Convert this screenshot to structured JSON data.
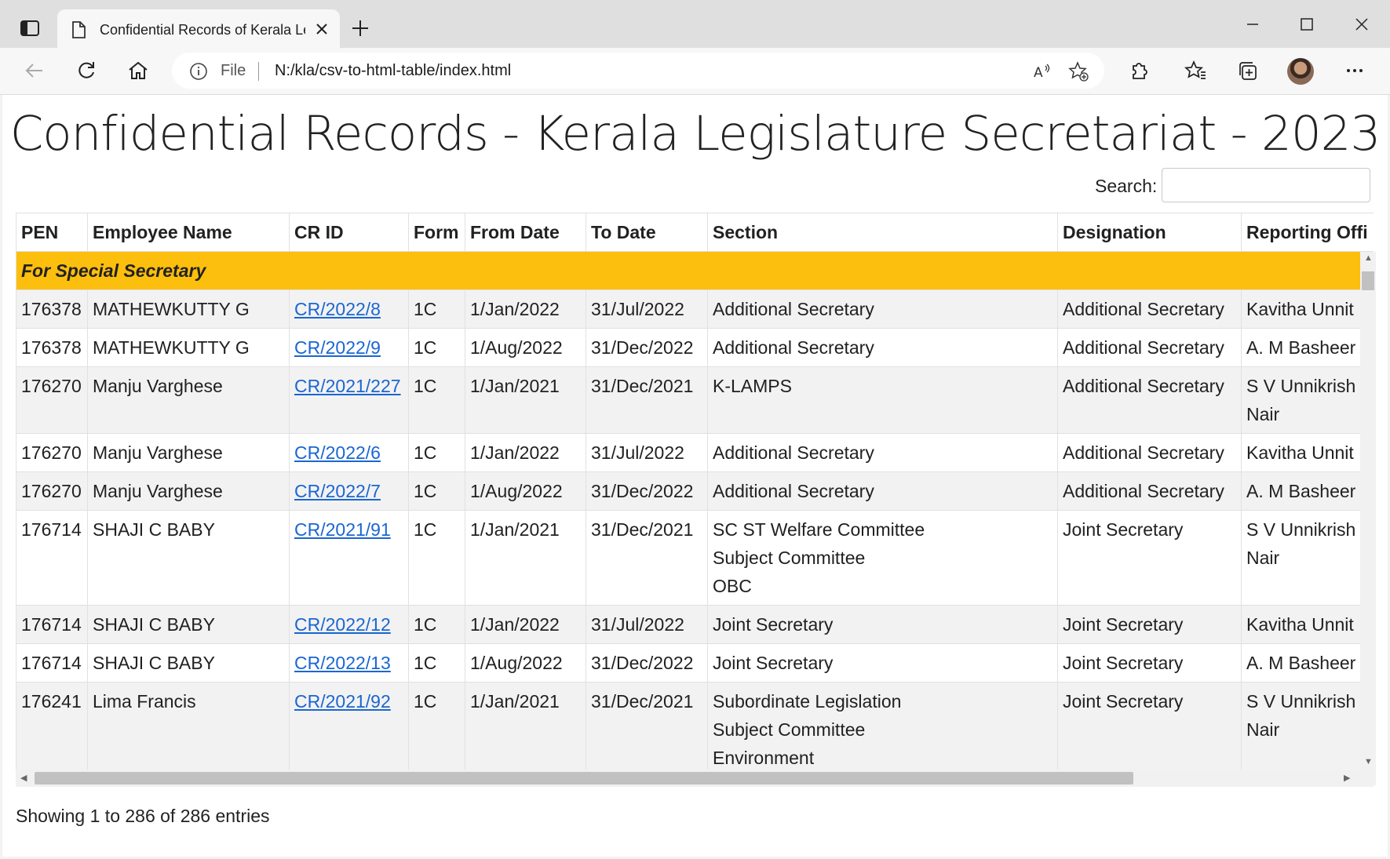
{
  "browser": {
    "tab_title": "Confidential Records of Kerala Le",
    "address_prefix": "File",
    "url": "N:/kla/csv-to-html-table/index.html"
  },
  "page": {
    "title": "Confidential Records - Kerala Legislature Secretariat - 2023",
    "search_label": "Search:",
    "search_value": "",
    "info": "Showing 1 to 286 of 286 entries"
  },
  "table": {
    "headers": [
      "PEN",
      "Employee Name",
      "CR ID",
      "Form",
      "From Date",
      "To Date",
      "Section",
      "Designation",
      "Reporting Offi"
    ],
    "group": "For Special Secretary",
    "rows": [
      {
        "pen": "176378",
        "name": "MATHEWKUTTY G",
        "cr": "CR/2022/8",
        "form": "1C",
        "from": "1/Jan/2022",
        "to": "31/Jul/2022",
        "section": [
          "Additional Secretary"
        ],
        "designation": "Additional Secretary",
        "officer": [
          "Kavitha Unnit"
        ]
      },
      {
        "pen": "176378",
        "name": "MATHEWKUTTY G",
        "cr": "CR/2022/9",
        "form": "1C",
        "from": "1/Aug/2022",
        "to": "31/Dec/2022",
        "section": [
          "Additional Secretary"
        ],
        "designation": "Additional Secretary",
        "officer": [
          "A. M Basheer"
        ]
      },
      {
        "pen": "176270",
        "name": "Manju Varghese",
        "cr": "CR/2021/227",
        "form": "1C",
        "from": "1/Jan/2021",
        "to": "31/Dec/2021",
        "section": [
          "K-LAMPS"
        ],
        "designation": "Additional Secretary",
        "officer": [
          "S V Unnikrish",
          "Nair"
        ]
      },
      {
        "pen": "176270",
        "name": "Manju Varghese",
        "cr": "CR/2022/6",
        "form": "1C",
        "from": "1/Jan/2022",
        "to": "31/Jul/2022",
        "section": [
          "Additional Secretary"
        ],
        "designation": "Additional Secretary",
        "officer": [
          "Kavitha Unnit"
        ]
      },
      {
        "pen": "176270",
        "name": "Manju Varghese",
        "cr": "CR/2022/7",
        "form": "1C",
        "from": "1/Aug/2022",
        "to": "31/Dec/2022",
        "section": [
          "Additional Secretary"
        ],
        "designation": "Additional Secretary",
        "officer": [
          "A. M Basheer"
        ]
      },
      {
        "pen": "176714",
        "name": "SHAJI C BABY",
        "cr": "CR/2021/91",
        "form": "1C",
        "from": "1/Jan/2021",
        "to": "31/Dec/2021",
        "section": [
          "SC ST Welfare Committee",
          "Subject Committee",
          "OBC"
        ],
        "designation": "Joint Secretary",
        "officer": [
          "S V Unnikrish",
          "Nair"
        ]
      },
      {
        "pen": "176714",
        "name": "SHAJI C BABY",
        "cr": "CR/2022/12",
        "form": "1C",
        "from": "1/Jan/2022",
        "to": "31/Jul/2022",
        "section": [
          "Joint Secretary"
        ],
        "designation": "Joint Secretary",
        "officer": [
          "Kavitha Unnit"
        ]
      },
      {
        "pen": "176714",
        "name": "SHAJI C BABY",
        "cr": "CR/2022/13",
        "form": "1C",
        "from": "1/Aug/2022",
        "to": "31/Dec/2022",
        "section": [
          "Joint Secretary"
        ],
        "designation": "Joint Secretary",
        "officer": [
          "A. M Basheer"
        ]
      },
      {
        "pen": "176241",
        "name": "Lima Francis",
        "cr": "CR/2021/92",
        "form": "1C",
        "from": "1/Jan/2021",
        "to": "31/Dec/2021",
        "section": [
          "Subordinate Legislation",
          "Subject Committee",
          "Environment"
        ],
        "designation": "Joint Secretary",
        "officer": [
          "S V Unnikrish",
          "Nair"
        ]
      }
    ]
  }
}
